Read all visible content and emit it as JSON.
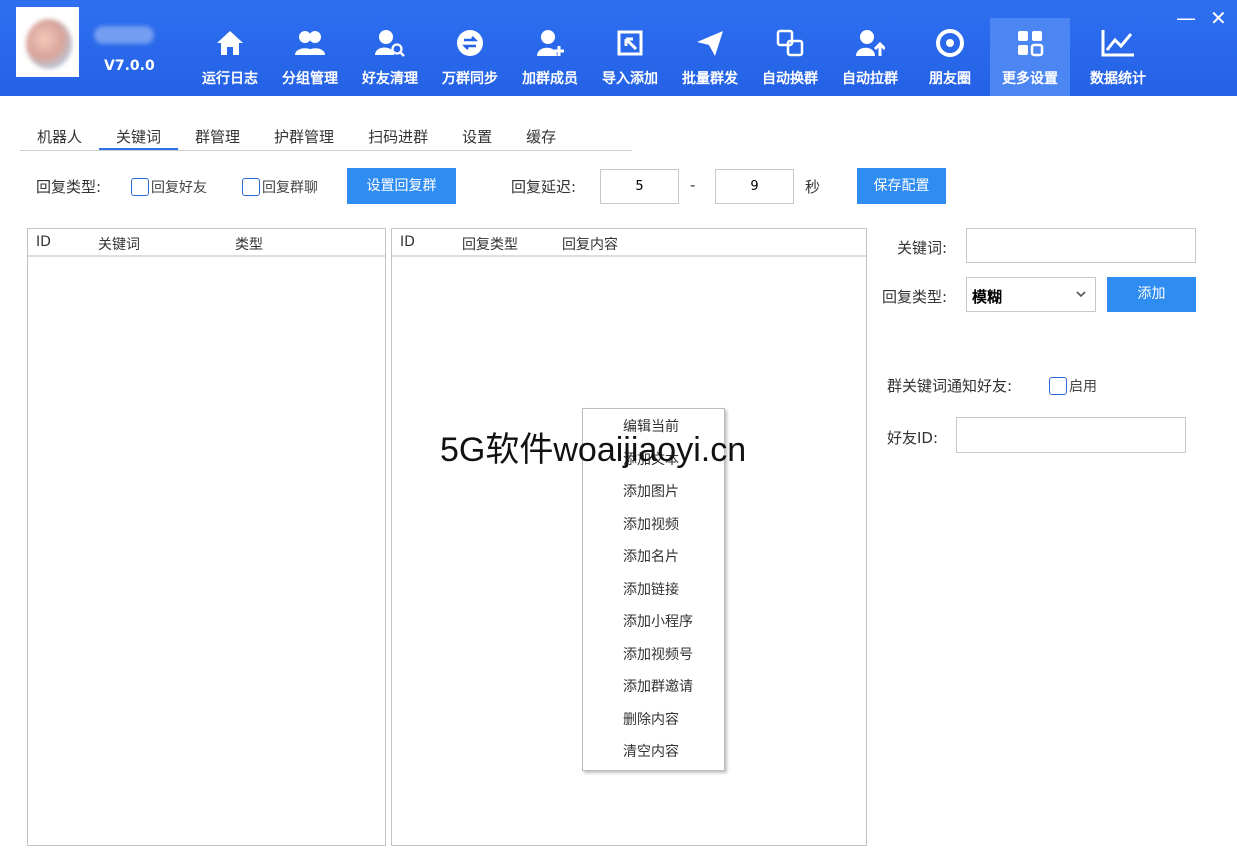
{
  "header": {
    "version": "V7.0.0",
    "nav": [
      {
        "label": "运行日志",
        "icon": "home-icon"
      },
      {
        "label": "分组管理",
        "icon": "users-icon"
      },
      {
        "label": "好友清理",
        "icon": "user-search-icon"
      },
      {
        "label": "万群同步",
        "icon": "sync-icon"
      },
      {
        "label": "加群成员",
        "icon": "user-add-icon"
      },
      {
        "label": "导入添加",
        "icon": "import-icon"
      },
      {
        "label": "批量群发",
        "icon": "send-icon"
      },
      {
        "label": "自动换群",
        "icon": "swap-icon"
      },
      {
        "label": "自动拉群",
        "icon": "user-up-icon"
      },
      {
        "label": "朋友圈",
        "icon": "camera-icon"
      },
      {
        "label": "更多设置",
        "icon": "grid-icon"
      },
      {
        "label": "数据统计",
        "icon": "chart-icon"
      }
    ],
    "active_nav": "更多设置",
    "minimize": "—",
    "close": "✕"
  },
  "tabs": [
    "机器人",
    "关键词",
    "群管理",
    "护群管理",
    "扫码进群",
    "设置",
    "缓存"
  ],
  "active_tab": "关键词",
  "options": {
    "reply_type_label": "回复类型:",
    "reply_friend": "回复好友",
    "reply_group": "回复群聊",
    "set_group_btn": "设置回复群",
    "delay_label": "回复延迟:",
    "delay_min": "5",
    "delay_sep": "-",
    "delay_max": "9",
    "delay_unit": "秒",
    "save_btn": "保存配置"
  },
  "keyword_table": {
    "columns": [
      "ID",
      "关键词",
      "类型"
    ]
  },
  "reply_table": {
    "columns": [
      "ID",
      "回复类型",
      "回复内容"
    ]
  },
  "context_menu": [
    "编辑当前",
    "添加文本",
    "添加图片",
    "添加视频",
    "添加名片",
    "添加链接",
    "添加小程序",
    "添加视频号",
    "添加群邀请",
    "删除内容",
    "清空内容"
  ],
  "right_panel": {
    "keyword_label": "关键词:",
    "keyword_value": "",
    "reply_type_label": "回复类型:",
    "reply_type_value": "模糊",
    "add_btn": "添加",
    "notify_label": "群关键词通知好友:",
    "enable_label": "启用",
    "friend_id_label": "好友ID:",
    "friend_id_value": ""
  },
  "watermark": "5G软件woaijiaoyi.cn"
}
